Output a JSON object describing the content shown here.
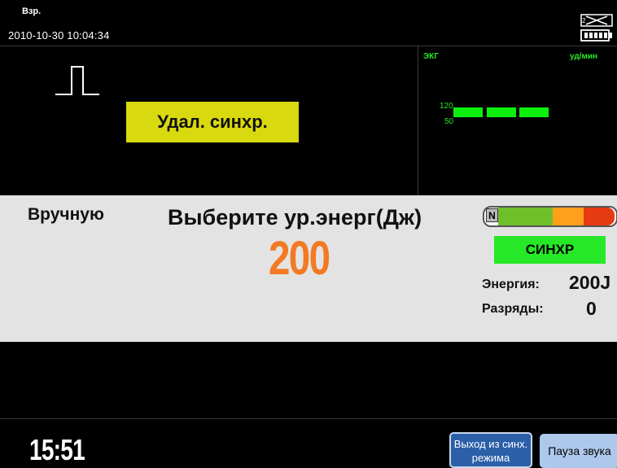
{
  "header": {
    "patient_mode": "Взр.",
    "datetime": "2010-10-30 10:04:34",
    "status_icons": [
      "cable-icon",
      "battery-icon"
    ]
  },
  "ecg": {
    "label": "ЭКГ",
    "hr_unit": "уд/мин",
    "alarm_limit_high": "120",
    "alarm_limit_low": "50",
    "alert_text": "Удал. синхр.",
    "alert_color": "#d9d90f",
    "heart_rate_color": "#0df00d"
  },
  "main": {
    "mode": "Вручную",
    "prompt": "Выберите ур.энерг(Дж)",
    "selected_energy": "200",
    "energy_color": "#f37a22",
    "charge_indicator_label": "N",
    "sync_badge": "СИНХР",
    "energy_label": "Энергия:",
    "energy_value": "200J",
    "shocks_label": "Разряды:",
    "shocks_value": "0"
  },
  "footer": {
    "clock": "15:51",
    "exit_sync_label": "Выход из синх. режима",
    "mute_label": "Пауза звука"
  }
}
